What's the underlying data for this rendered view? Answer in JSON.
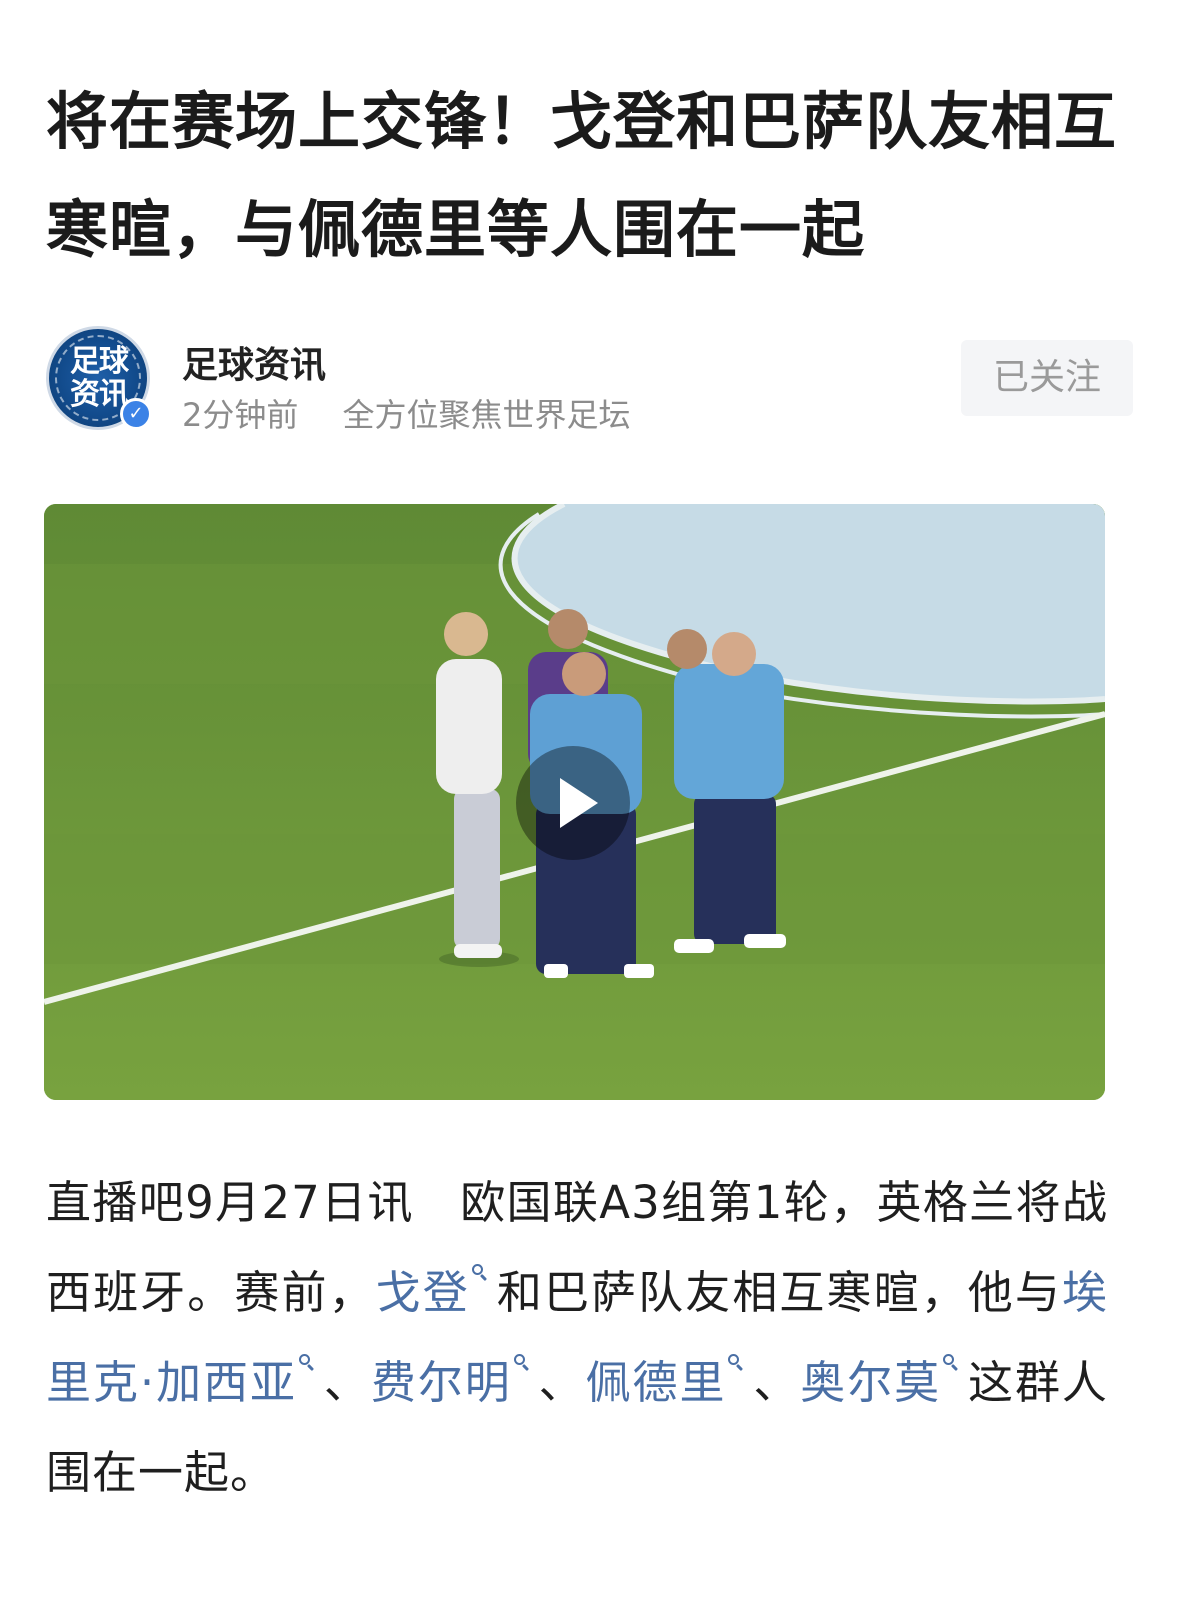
{
  "article": {
    "title": "将在赛场上交锋！戈登和巴萨队友相互寒暄，与佩德里等人围在一起"
  },
  "author": {
    "avatar_text_line1": "足球",
    "avatar_text_line2": "资讯",
    "name": "足球资讯",
    "time": "2分钟前",
    "description": "全方位聚焦世界足坛",
    "verified": true,
    "follow_label": "已关注"
  },
  "video": {
    "has_play_button": true
  },
  "body": {
    "segments": [
      {
        "type": "text",
        "text": "直播吧9月27日讯　欧国联A3组第1轮，英格兰将战西班牙。赛前，"
      },
      {
        "type": "link",
        "text": "戈登"
      },
      {
        "type": "text",
        "text": "和巴萨队友相互寒暄，他与"
      },
      {
        "type": "link",
        "text": "埃里克·加西亚"
      },
      {
        "type": "text",
        "text": "、"
      },
      {
        "type": "link",
        "text": "费尔明"
      },
      {
        "type": "text",
        "text": "、"
      },
      {
        "type": "link",
        "text": "佩德里"
      },
      {
        "type": "text",
        "text": "、"
      },
      {
        "type": "link",
        "text": "奥尔莫"
      },
      {
        "type": "text",
        "text": "这群人围在一起。"
      }
    ]
  },
  "colors": {
    "link": "#4a6fa5",
    "follow_bg": "#f4f5f7",
    "meta_text": "#8c8c8c"
  }
}
